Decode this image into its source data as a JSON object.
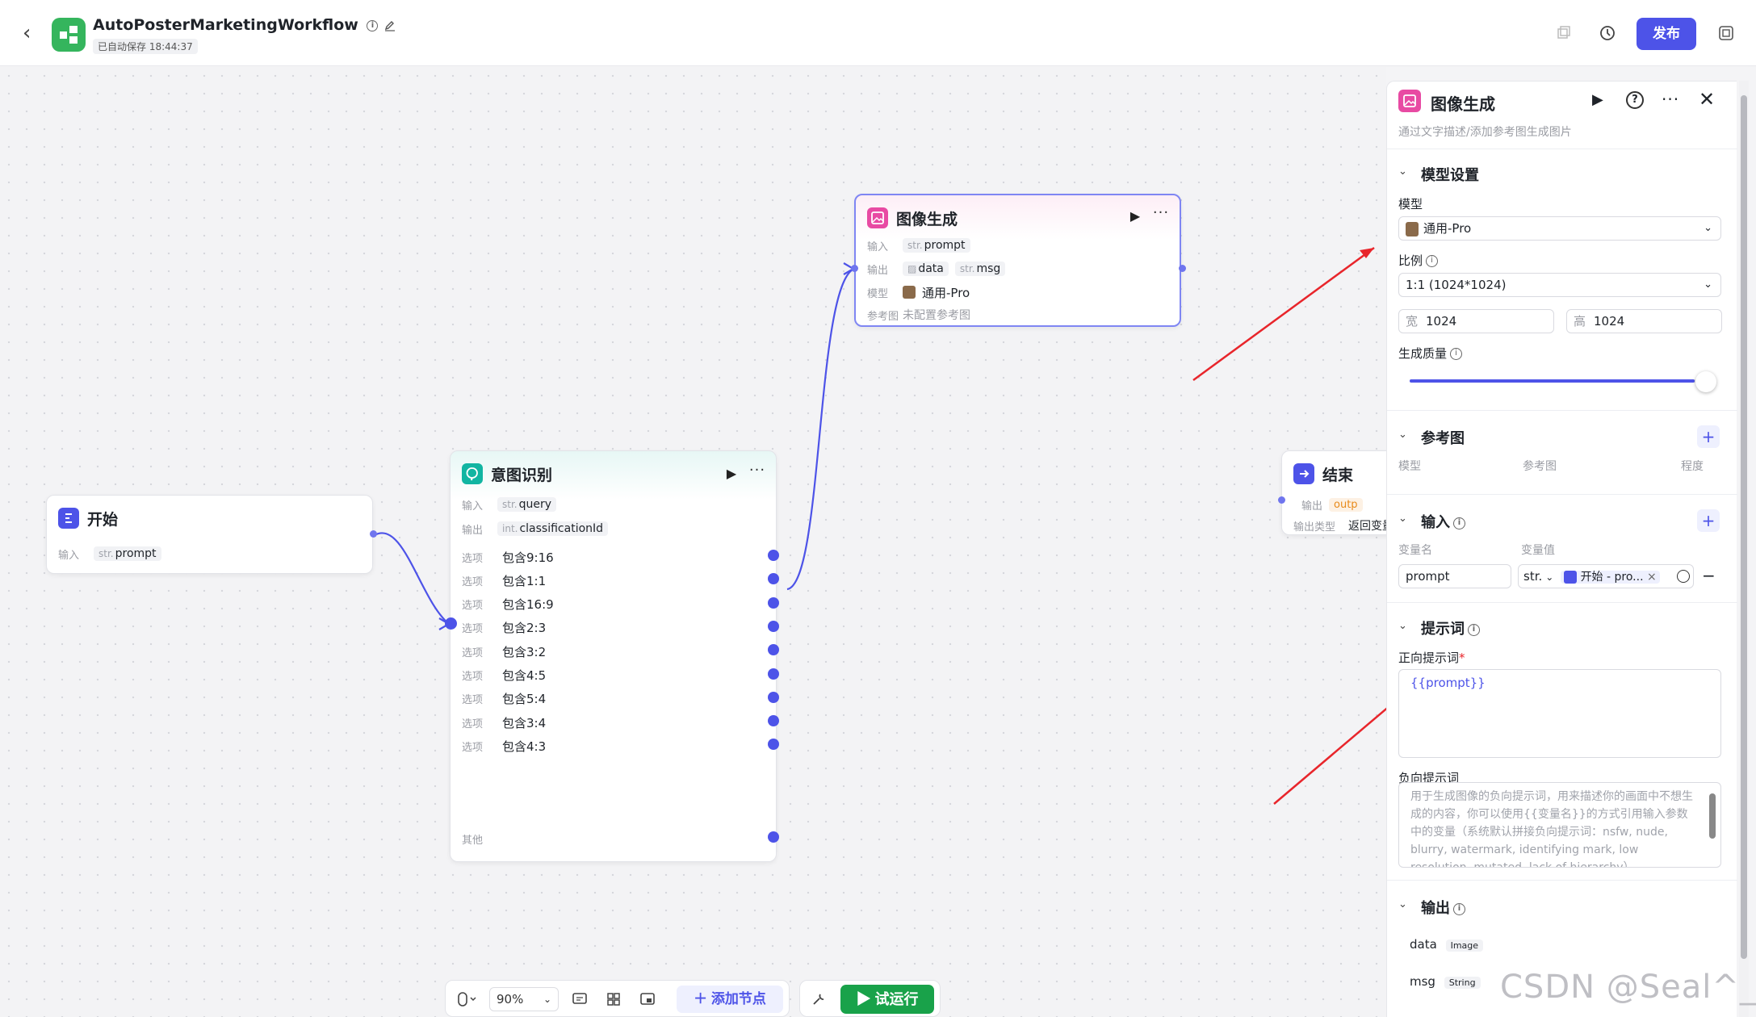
{
  "header": {
    "back_icon": "chevron-left-icon",
    "app_icon": "workflow-icon",
    "title": "AutoPosterMarketingWorkflow",
    "saved": "已自动保存 18:44:37",
    "publish": "发布"
  },
  "nodes": {
    "start": {
      "title": "开始",
      "in_label": "输入",
      "in_type": "str.",
      "in_var": "prompt"
    },
    "intent": {
      "title": "意图识别",
      "in_label": "输入",
      "in_type": "str.",
      "in_var": "query",
      "out_label": "输出",
      "out_type": "int.",
      "out_var": "classificationId",
      "options": [
        {
          "label": "选项",
          "value": "包含9:16"
        },
        {
          "label": "选项",
          "value": "包含1:1"
        },
        {
          "label": "选项",
          "value": "包含16:9"
        },
        {
          "label": "选项",
          "value": "包含2:3"
        },
        {
          "label": "选项",
          "value": "包含3:2"
        },
        {
          "label": "选项",
          "value": "包含4:5"
        },
        {
          "label": "选项",
          "value": "包含5:4"
        },
        {
          "label": "选项",
          "value": "包含3:4"
        },
        {
          "label": "选项",
          "value": "包含4:3"
        }
      ],
      "other": "其他"
    },
    "image": {
      "title": "图像生成",
      "in_label": "输入",
      "in_type": "str.",
      "in_var": "prompt",
      "out_label": "输出",
      "out_var1": "data",
      "out_type2": "str.",
      "out_var2": "msg",
      "model_label": "模型",
      "model": "通用-Pro",
      "ref_label": "参考图",
      "ref_value": "未配置参考图"
    },
    "end": {
      "title": "结束",
      "out_label": "输出",
      "out_var": "outp",
      "out_type_label": "输出类型",
      "out_type_value": "返回变量"
    }
  },
  "toolbar": {
    "zoom": "90%",
    "add_node": "添加节点",
    "run": "试运行"
  },
  "panel": {
    "title": "图像生成",
    "desc": "通过文字描述/添加参考图生成图片",
    "model_section": "模型设置",
    "model_label": "模型",
    "model_value": "通用-Pro",
    "ratio_label": "比例",
    "ratio_value": "1:1 (1024*1024)",
    "width_label": "宽",
    "width_value": "1024",
    "height_label": "高",
    "height_value": "1024",
    "quality_label": "生成质量",
    "quality_level": 0.95,
    "ref_section": "参考图",
    "ref_col1": "模型",
    "ref_col2": "参考图",
    "ref_col3": "程度",
    "input_section": "输入",
    "var_name_label": "变量名",
    "var_value_label": "变量值",
    "var_name": "prompt",
    "var_type": "str.",
    "var_ref": "开始 - pro...",
    "prompt_section": "提示词",
    "positive_label": "正向提示词",
    "required_mark": "*",
    "positive_value": "{{prompt}}",
    "negative_label": "负向提示词",
    "negative_placeholder": "用于生成图像的负向提示词，用来描述你的画面中不想生成的内容，你可以使用{{变量名}}的方式引用输入参数中的变量（系统默认拼接负向提示词：nsfw, nude, blurry, watermark, identifying mark, low resolution, mutated, lack of hierarchy）",
    "output_section": "输出",
    "out1_name": "data",
    "out1_type": "Image",
    "out2_name": "msg",
    "out2_type": "String"
  },
  "watermark": "CSDN @Seal^_^",
  "colors": {
    "accent": "#4d53e8",
    "run_green": "#19a24a",
    "image_node": "#e84aa3",
    "arrow": "#e8252b"
  }
}
